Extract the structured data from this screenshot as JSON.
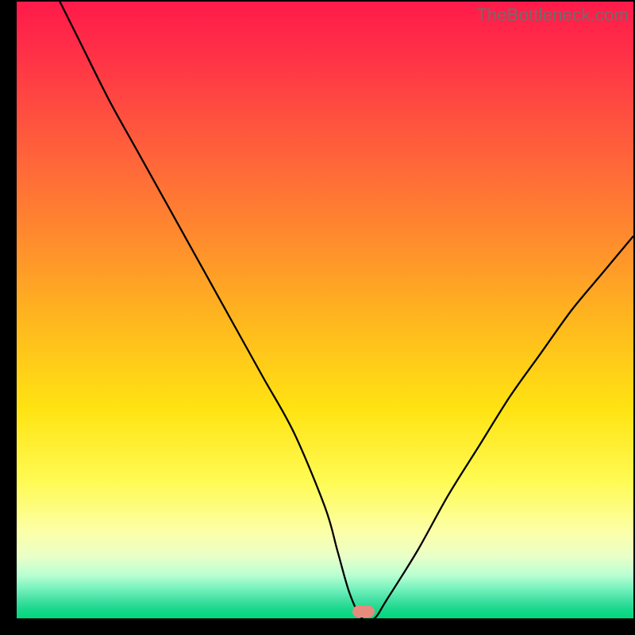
{
  "attribution": "TheBottleneck.com",
  "marker": {
    "x_frac": 0.562,
    "y_frac": 0.99
  },
  "chart_data": {
    "type": "line",
    "title": "",
    "xlabel": "",
    "ylabel": "",
    "xlim": [
      0,
      100
    ],
    "ylim": [
      0,
      100
    ],
    "grid": false,
    "legend": false,
    "series": [
      {
        "name": "bottleneck-curve",
        "x": [
          7,
          10,
          15,
          20,
          25,
          30,
          35,
          40,
          45,
          50,
          52,
          54,
          56,
          58,
          60,
          65,
          70,
          75,
          80,
          85,
          90,
          95,
          100
        ],
        "y": [
          100,
          94,
          84,
          75,
          66,
          57,
          48,
          39,
          30,
          18,
          11,
          4,
          0,
          0,
          3,
          11,
          20,
          28,
          36,
          43,
          50,
          56,
          62
        ]
      }
    ],
    "annotations": [
      {
        "name": "optimal-marker",
        "x": 57,
        "y": 0,
        "shape": "pill",
        "color": "#e58c7e"
      }
    ],
    "background_gradient": {
      "direction": "vertical",
      "stops": [
        {
          "pos": 0.0,
          "color": "#ff1a4a"
        },
        {
          "pos": 0.5,
          "color": "#ffb81e"
        },
        {
          "pos": 0.8,
          "color": "#fffb55"
        },
        {
          "pos": 1.0,
          "color": "#00d77e"
        }
      ]
    }
  }
}
